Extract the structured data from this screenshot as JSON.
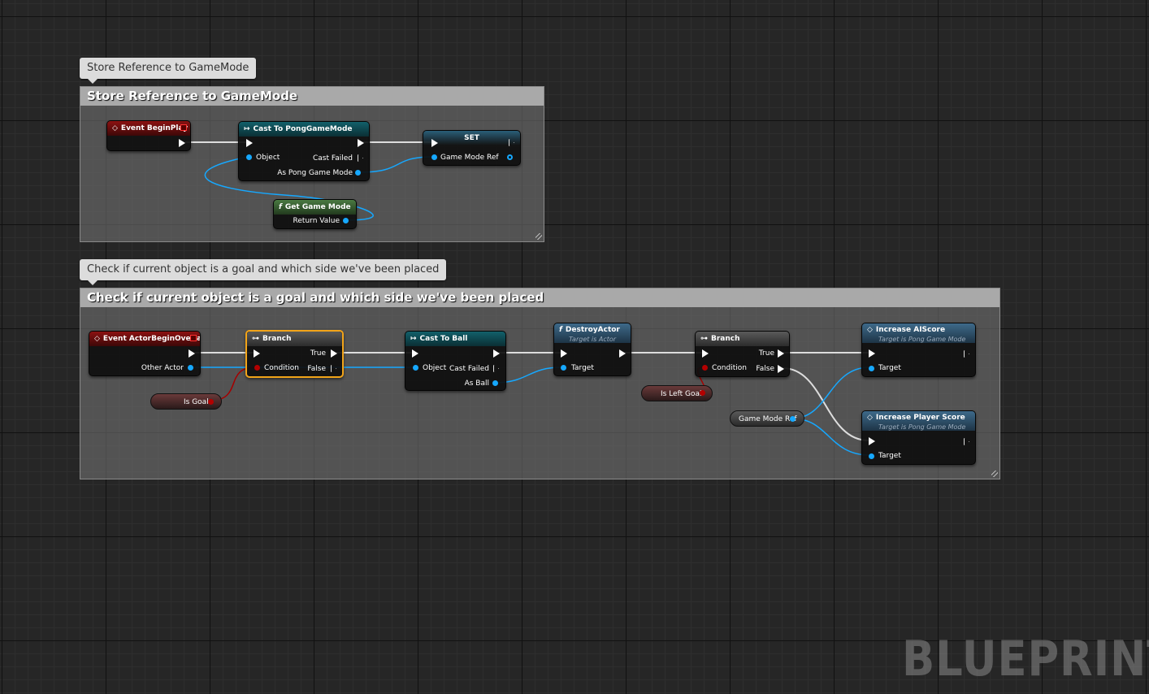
{
  "comments": [
    {
      "bubble": "Store Reference to GameMode",
      "title": "Store Reference to GameMode"
    },
    {
      "bubble": "Check if current object is a goal and which side we've been placed",
      "title": "Check if current object is a goal and which side we've been placed"
    }
  ],
  "nodes": {
    "event_begin_play": {
      "title": "Event BeginPlay"
    },
    "cast_pong": {
      "title": "Cast To PongGameMode",
      "in_object": "Object",
      "out_failed": "Cast Failed",
      "out_as": "As Pong Game Mode"
    },
    "set_node": {
      "title": "SET",
      "pin": "Game Mode Ref"
    },
    "get_game_mode": {
      "title": "Get Game Mode",
      "out": "Return Value"
    },
    "event_overlap": {
      "title": "Event ActorBeginOverlap",
      "out": "Other Actor"
    },
    "branch1": {
      "title": "Branch",
      "cond": "Condition",
      "true": "True",
      "false": "False"
    },
    "is_goal": {
      "label": "Is Goal"
    },
    "cast_ball": {
      "title": "Cast To Ball",
      "in_object": "Object",
      "out_failed": "Cast Failed",
      "out_as": "As Ball"
    },
    "destroy_actor": {
      "title": "DestroyActor",
      "subtitle": "Target is Actor",
      "target": "Target"
    },
    "branch2": {
      "title": "Branch",
      "cond": "Condition",
      "true": "True",
      "false": "False"
    },
    "is_left_goal": {
      "label": "Is Left Goal"
    },
    "game_mode_ref": {
      "label": "Game Mode Ref"
    },
    "increase_ai": {
      "title": "Increase AIScore",
      "subtitle": "Target is Pong Game Mode",
      "target": "Target"
    },
    "increase_player": {
      "title": "Increase Player Score",
      "subtitle": "Target is Pong Game Mode",
      "target": "Target"
    }
  },
  "watermark": "BLUEPRINT",
  "colors": {
    "exec": "#ffffff",
    "object_pin": "#16a8ff",
    "bool_pin": "#b30000",
    "selection": "#f2a419"
  }
}
